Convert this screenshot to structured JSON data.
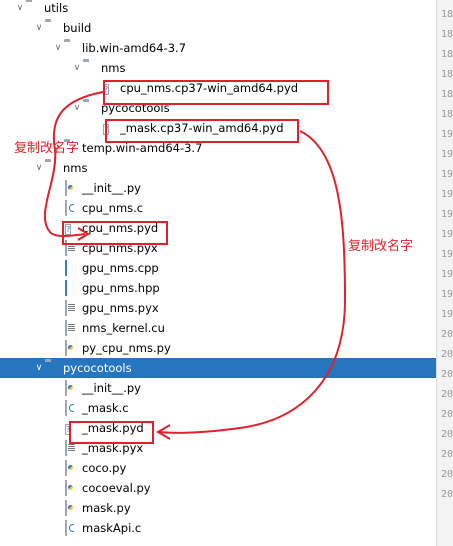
{
  "tree": [
    {
      "label": "utils",
      "kind": "folder",
      "expanded": true
    },
    {
      "label": "build",
      "kind": "folder",
      "expanded": true
    },
    {
      "label": "lib.win-amd64-3.7",
      "kind": "folder",
      "expanded": true
    },
    {
      "label": "nms",
      "kind": "folder",
      "expanded": true
    },
    {
      "label": "cpu_nms.cp37-win_amd64.pyd",
      "kind": "unknown"
    },
    {
      "label": "pycocotools",
      "kind": "folder",
      "expanded": true
    },
    {
      "label": "_mask.cp37-win_amd64.pyd",
      "kind": "unknown"
    },
    {
      "label": "temp.win-amd64-3.7",
      "kind": "folder",
      "expanded": false
    },
    {
      "label": "nms",
      "kind": "folder",
      "expanded": true
    },
    {
      "label": "__init__.py",
      "kind": "py"
    },
    {
      "label": "cpu_nms.c",
      "kind": "c"
    },
    {
      "label": "cpu_nms.pyd",
      "kind": "unknown"
    },
    {
      "label": "cpu_nms.pyx",
      "kind": "txt"
    },
    {
      "label": "gpu_nms.cpp",
      "kind": "blue"
    },
    {
      "label": "gpu_nms.hpp",
      "kind": "blue"
    },
    {
      "label": "gpu_nms.pyx",
      "kind": "txt"
    },
    {
      "label": "nms_kernel.cu",
      "kind": "txt"
    },
    {
      "label": "py_cpu_nms.py",
      "kind": "py"
    },
    {
      "label": "pycocotools",
      "kind": "folder",
      "expanded": true,
      "selected": true
    },
    {
      "label": "__init__.py",
      "kind": "py"
    },
    {
      "label": "_mask.c",
      "kind": "c"
    },
    {
      "label": "_mask.pyd",
      "kind": "unknown"
    },
    {
      "label": "_mask.pyx",
      "kind": "txt"
    },
    {
      "label": "coco.py",
      "kind": "py"
    },
    {
      "label": "cocoeval.py",
      "kind": "py"
    },
    {
      "label": "mask.py",
      "kind": "py"
    },
    {
      "label": "maskApi.c",
      "kind": "c"
    }
  ],
  "line_numbers": [
    "18",
    "18",
    "18",
    "18",
    "18",
    "18",
    "19",
    "19",
    "19",
    "19",
    "19",
    "19",
    "19",
    "19",
    "19",
    "19",
    "20",
    "20",
    "20",
    "20",
    "20",
    "20",
    "20",
    "20",
    "20"
  ],
  "annotations": {
    "copy_rename_left": "复制改名字",
    "copy_rename_right": "复制改名字"
  },
  "colors": {
    "selection": "#2675bf",
    "annotation": "#e0202a"
  }
}
